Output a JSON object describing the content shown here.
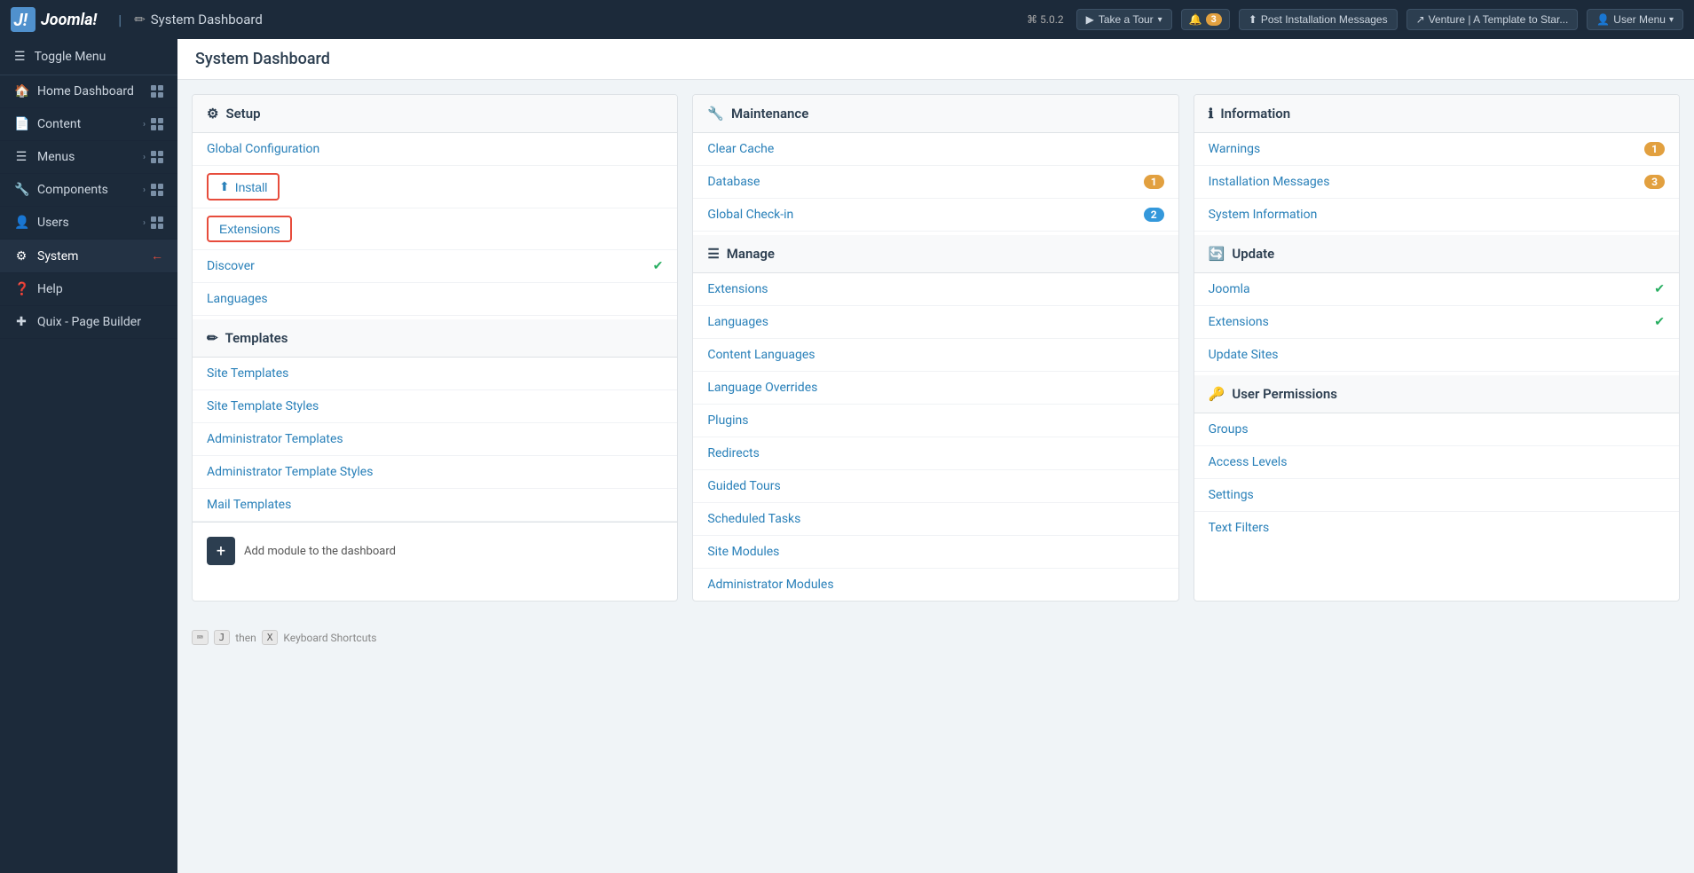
{
  "topbar": {
    "logo_text": "Joomla!",
    "title": "System Dashboard",
    "title_icon": "✏",
    "version": "⌘ 5.0.2",
    "take_a_tour_label": "Take a Tour",
    "notification_count": "3",
    "post_install_label": "Post Installation Messages",
    "venture_label": "Venture | A Template to Star...",
    "user_menu_label": "User Menu"
  },
  "sidebar": {
    "toggle_label": "Toggle Menu",
    "items": [
      {
        "label": "Home Dashboard",
        "icon": "🏠",
        "has_arrow": false,
        "has_grid": true,
        "active": false
      },
      {
        "label": "Content",
        "icon": "📄",
        "has_arrow": true,
        "has_grid": true,
        "active": false
      },
      {
        "label": "Menus",
        "icon": "☰",
        "has_arrow": true,
        "has_grid": true,
        "active": false
      },
      {
        "label": "Components",
        "icon": "🔧",
        "has_arrow": true,
        "has_grid": true,
        "active": false
      },
      {
        "label": "Users",
        "icon": "👤",
        "has_arrow": true,
        "has_grid": true,
        "active": false
      },
      {
        "label": "System",
        "icon": "⚙",
        "has_arrow": false,
        "has_grid": false,
        "active": true
      },
      {
        "label": "Help",
        "icon": "❓",
        "has_arrow": false,
        "has_grid": false,
        "active": false
      },
      {
        "label": "Quix - Page Builder",
        "icon": "✚",
        "has_arrow": false,
        "has_grid": false,
        "active": false
      }
    ]
  },
  "page_title": "System Dashboard",
  "setup_card": {
    "header": "Setup",
    "header_icon": "⚙",
    "items": [
      {
        "label": "Global Configuration",
        "type": "link"
      },
      {
        "label": "Install",
        "type": "install-btn"
      },
      {
        "label": "Extensions",
        "type": "extensions-btn"
      },
      {
        "label": "Discover",
        "type": "link-check"
      },
      {
        "label": "Languages",
        "type": "link"
      }
    ],
    "templates_header": "Templates",
    "templates_icon": "✏",
    "template_items": [
      {
        "label": "Site Templates"
      },
      {
        "label": "Site Template Styles"
      },
      {
        "label": "Administrator Templates"
      },
      {
        "label": "Administrator Template Styles"
      },
      {
        "label": "Mail Templates"
      }
    ],
    "add_module_label": "Add module to the dashboard"
  },
  "maintenance_card": {
    "header": "Maintenance",
    "header_icon": "🔧",
    "items": [
      {
        "label": "Clear Cache",
        "badge": null
      },
      {
        "label": "Database",
        "badge": "1",
        "badge_type": "orange"
      },
      {
        "label": "Global Check-in",
        "badge": "2",
        "badge_type": "blue"
      }
    ],
    "manage_header": "Manage",
    "manage_icon": "☰",
    "manage_items": [
      {
        "label": "Extensions"
      },
      {
        "label": "Languages"
      },
      {
        "label": "Content Languages"
      },
      {
        "label": "Language Overrides"
      },
      {
        "label": "Plugins"
      },
      {
        "label": "Redirects"
      },
      {
        "label": "Guided Tours"
      },
      {
        "label": "Scheduled Tasks"
      },
      {
        "label": "Site Modules"
      },
      {
        "label": "Administrator Modules"
      }
    ]
  },
  "information_card": {
    "header": "Information",
    "header_icon": "ℹ",
    "items": [
      {
        "label": "Warnings",
        "badge": "1",
        "badge_type": "orange"
      },
      {
        "label": "Installation Messages",
        "badge": "3",
        "badge_type": "orange"
      },
      {
        "label": "System Information",
        "badge": null
      }
    ],
    "update_header": "Update",
    "update_icon": "🔄",
    "update_items": [
      {
        "label": "Joomla",
        "check": true
      },
      {
        "label": "Extensions",
        "check": true
      },
      {
        "label": "Update Sites",
        "check": false
      }
    ],
    "permissions_header": "User Permissions",
    "permissions_icon": "🔑",
    "permissions_items": [
      {
        "label": "Groups"
      },
      {
        "label": "Access Levels"
      },
      {
        "label": "Settings"
      },
      {
        "label": "Text Filters"
      }
    ]
  },
  "keyboard": {
    "hint": "then",
    "key1": "J",
    "key2": "X",
    "label": "Keyboard Shortcuts"
  }
}
